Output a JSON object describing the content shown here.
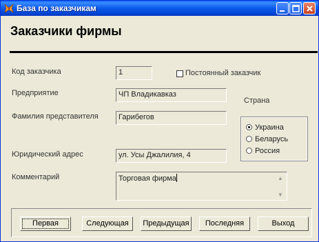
{
  "window": {
    "title": "Бaзa пo зaкaзчикaм",
    "icon": "app-icon",
    "controls": [
      "minimize-icon",
      "maximize-icon",
      "close-icon"
    ]
  },
  "header": {
    "title": "Заказчики фирмы"
  },
  "form": {
    "customer_code": {
      "label": "Код заказчика",
      "value": "1"
    },
    "permanent": {
      "label": "Постоянный заказчик",
      "checked": false
    },
    "company": {
      "label": "Предприятие",
      "value": "ЧП Владикавказ"
    },
    "representative": {
      "label": "Фамилия представителя",
      "value": "Гарибегов"
    },
    "address": {
      "label": "Юридический адрес",
      "value": "ул. Усы Джалилия, 4"
    },
    "comment": {
      "label": "Комментарий",
      "value": "Торговая фирма"
    },
    "country": {
      "label": "Страна",
      "options": [
        "Украина",
        "Беларусь",
        "Россия"
      ],
      "selected": "Украина"
    }
  },
  "buttons": {
    "first": "Первая",
    "next": "Следующая",
    "previous": "Предыдущая",
    "last": "Последняя",
    "exit": "Выход"
  },
  "colors": {
    "titlebar": "#0a5ae8",
    "face": "#ece9d8",
    "rule": "#000000"
  }
}
